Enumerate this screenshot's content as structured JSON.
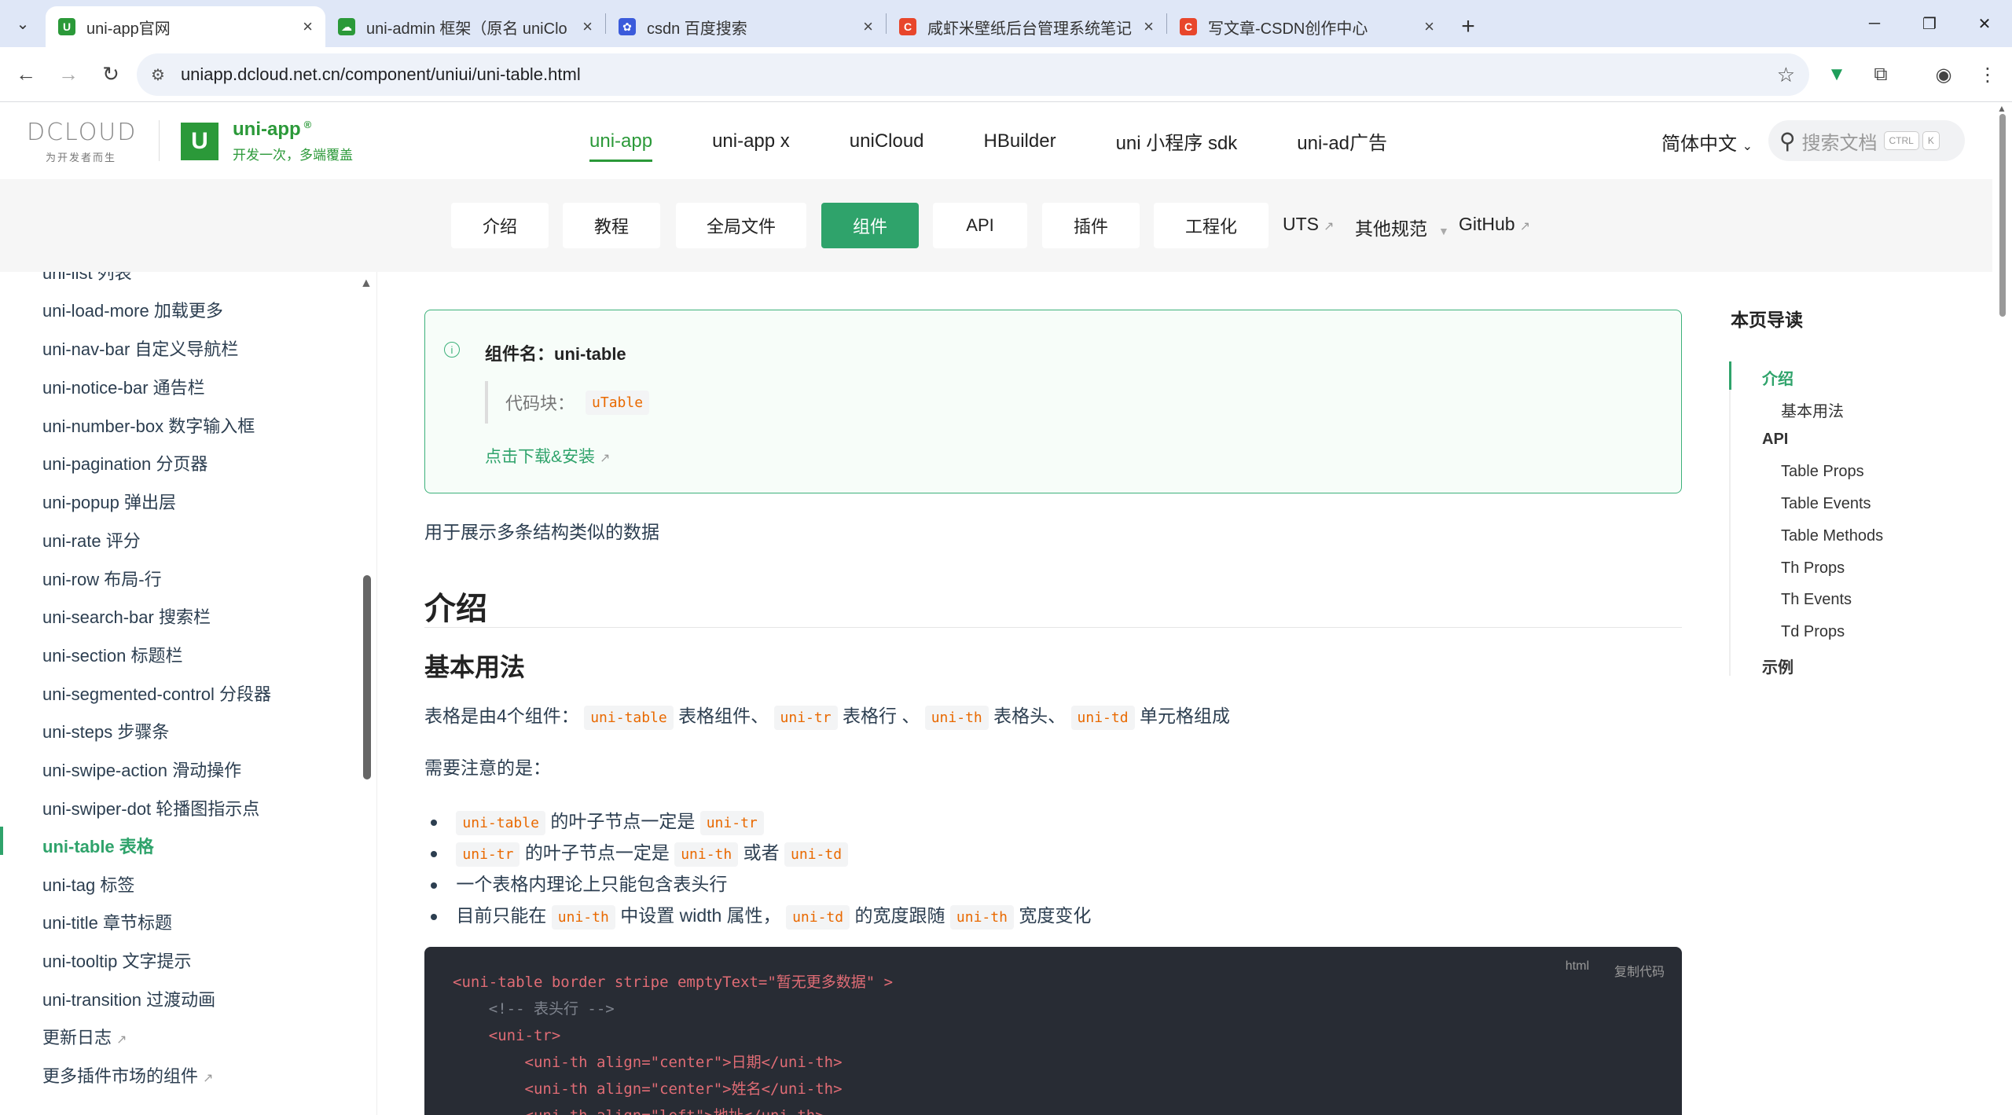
{
  "browser": {
    "tabs": [
      {
        "title": "uni-app官网",
        "favicon_color": "#2b9939",
        "favicon_char": "U",
        "active": true
      },
      {
        "title": "uni-admin 框架（原名 uniClo",
        "favicon_color": "#2b9939",
        "favicon_char": "☁",
        "active": false
      },
      {
        "title": "csdn 百度搜索",
        "favicon_color": "#3b5bdb",
        "favicon_char": "✿",
        "active": false
      },
      {
        "title": "咸虾米壁纸后台管理系统笔记 |",
        "favicon_color": "#e8462b",
        "favicon_char": "C",
        "active": false
      },
      {
        "title": "写文章-CSDN创作中心",
        "favicon_color": "#e8462b",
        "favicon_char": "C",
        "active": false
      }
    ],
    "url": "uniapp.dcloud.net.cn/component/uniui/uni-table.html"
  },
  "header": {
    "dcloud_logo": "DCLOUD",
    "dcloud_slogan": "为开发者而生",
    "product_name": "uni-app",
    "product_mark": "®",
    "product_tagline": "开发一次，多端覆盖",
    "nav": [
      "uni-app",
      "uni-app x",
      "uniCloud",
      "HBuilder",
      "uni 小程序 sdk",
      "uni-ad广告"
    ],
    "language": "简体中文",
    "search_placeholder": "搜索文档",
    "kbd_ctrl": "CTRL",
    "kbd_k": "K"
  },
  "subnav": {
    "pills": [
      "介绍",
      "教程",
      "全局文件",
      "组件",
      "API",
      "插件",
      "工程化"
    ],
    "active": "组件",
    "links": [
      "UTS",
      "其他规范",
      "GitHub"
    ]
  },
  "sidebar": {
    "items": [
      "uni-list 列表",
      "uni-load-more 加载更多",
      "uni-nav-bar 自定义导航栏",
      "uni-notice-bar 通告栏",
      "uni-number-box 数字输入框",
      "uni-pagination 分页器",
      "uni-popup 弹出层",
      "uni-rate 评分",
      "uni-row 布局-行",
      "uni-search-bar 搜索栏",
      "uni-section 标题栏",
      "uni-segmented-control 分段器",
      "uni-steps 步骤条",
      "uni-swipe-action 滑动操作",
      "uni-swiper-dot 轮播图指示点",
      "uni-table 表格",
      "uni-tag 标签",
      "uni-title 章节标题",
      "uni-tooltip 文字提示",
      "uni-transition 过渡动画",
      "更新日志",
      "更多插件市场的组件"
    ],
    "active_item": "uni-table 表格"
  },
  "main": {
    "tip_title": "组件名：uni-table",
    "tip_code_label": "代码块：",
    "tip_code": "uTable",
    "tip_download": "点击下载&安装",
    "desc": "用于展示多条结构类似的数据",
    "h1": "介绍",
    "h2": "基本用法",
    "intro_prefix": "表格是由4个组件：",
    "intro_c1": "uni-table",
    "intro_t1": "表格组件、",
    "intro_c2": "uni-tr",
    "intro_t2": "表格行 、",
    "intro_c3": "uni-th",
    "intro_t3": "表格头、",
    "intro_c4": "uni-td",
    "intro_t4": "单元格组成",
    "note": "需要注意的是：",
    "bullets": {
      "b1_c1": "uni-table",
      "b1_t1": "的叶子节点一定是",
      "b1_c2": "uni-tr",
      "b2_c1": "uni-tr",
      "b2_t1": "的叶子节点一定是",
      "b2_c2": "uni-th",
      "b2_t2": "或者",
      "b2_c3": "uni-td",
      "b3": "一个表格内理论上只能包含表头行",
      "b4_t0": "目前只能在",
      "b4_c1": "uni-th",
      "b4_t1": "中设置 width 属性，",
      "b4_c2": "uni-td",
      "b4_t2": "的宽度跟随",
      "b4_c3": "uni-th",
      "b4_t3": "宽度变化"
    },
    "code_lang": "html",
    "code_copy": "复制代码",
    "code_lines": [
      "<uni-table border stripe emptyText=\"暂无更多数据\" >",
      "    <!-- 表头行 -->",
      "    <uni-tr>",
      "        <uni-th align=\"center\">日期</uni-th>",
      "        <uni-th align=\"center\">姓名</uni-th>",
      "        <uni-th align=\"left\">地址</uni-th>"
    ]
  },
  "toc": {
    "title": "本页导读",
    "items": [
      {
        "label": "介绍",
        "level": 1,
        "active": true
      },
      {
        "label": "基本用法",
        "level": 2
      },
      {
        "label": "API",
        "level": 1
      },
      {
        "label": "Table Props",
        "level": 2
      },
      {
        "label": "Table Events",
        "level": 2
      },
      {
        "label": "Table Methods",
        "level": 2
      },
      {
        "label": "Th Props",
        "level": 2
      },
      {
        "label": "Th Events",
        "level": 2
      },
      {
        "label": "Td Props",
        "level": 2
      },
      {
        "label": "示例",
        "level": 1
      }
    ]
  },
  "colors": {
    "brand_green": "#2b9939",
    "accent_green": "#2fa36b",
    "code_bg": "#282c34"
  }
}
